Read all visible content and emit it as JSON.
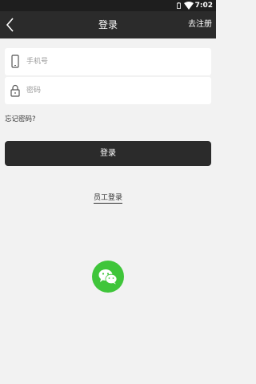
{
  "status_bar": {
    "time": "7:02"
  },
  "app_bar": {
    "title": "登录",
    "register_label": "去注册"
  },
  "form": {
    "phone_placeholder": "手机号",
    "password_placeholder": "密码",
    "forgot_label": "忘记密码?",
    "login_label": "登录",
    "staff_login_label": "员工登录"
  },
  "colors": {
    "app_bar": "#2b2b2b",
    "wechat": "#3fc53a",
    "background": "#f2f2f2"
  }
}
